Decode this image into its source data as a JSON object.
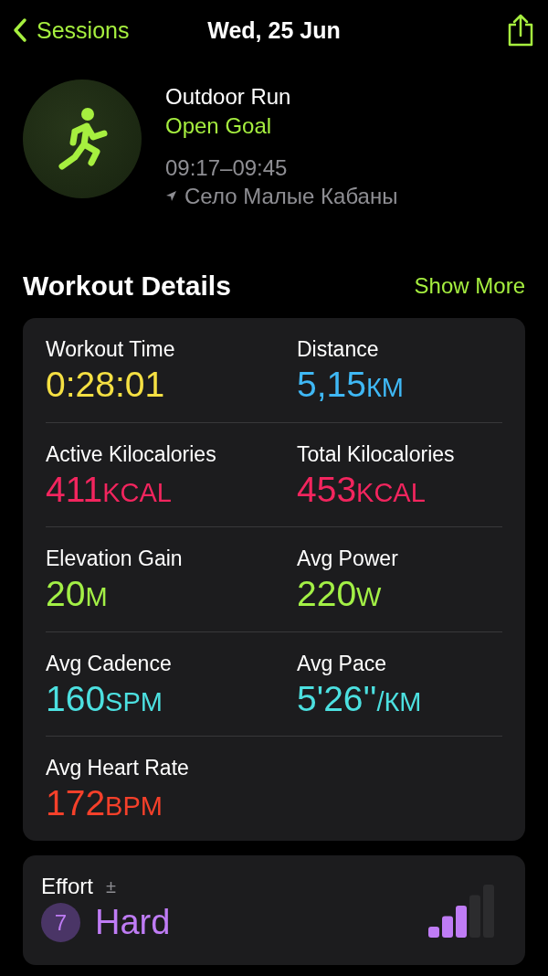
{
  "nav": {
    "back_label": "Sessions",
    "title": "Wed, 25 Jun"
  },
  "workout": {
    "name": "Outdoor Run",
    "goal": "Open Goal",
    "time_range": "09:17–09:45",
    "location": "Село Малые Кабаны"
  },
  "details": {
    "heading": "Workout Details",
    "more_link": "Show More",
    "metrics": [
      {
        "label": "Workout Time",
        "value": "0:28:01",
        "color": "#f5e043"
      },
      {
        "label": "Distance",
        "value": "5,15",
        "unit": "КМ",
        "color": "#3fb8f5"
      },
      {
        "label": "Active Kilocalories",
        "value": "411",
        "unit": "KCAL",
        "color": "#f2255e"
      },
      {
        "label": "Total Kilocalories",
        "value": "453",
        "unit": "KCAL",
        "color": "#f2255e"
      },
      {
        "label": "Elevation Gain",
        "value": "20",
        "unit": "М",
        "color": "#a3f046"
      },
      {
        "label": "Avg Power",
        "value": "220",
        "unit": "W",
        "color": "#a3f046"
      },
      {
        "label": "Avg Cadence",
        "value": "160",
        "unit": "SPM",
        "color": "#4ce0e0"
      },
      {
        "label": "Avg Pace",
        "value": "5'26''",
        "unit": "/КМ",
        "color": "#4ce0e0"
      },
      {
        "label": "Avg Heart Rate",
        "value": "172",
        "unit": "BPM",
        "color": "#f5402a"
      }
    ]
  },
  "effort": {
    "label": "Effort",
    "adjust": "±",
    "score": "7",
    "rating": "Hard",
    "level": 0.6
  }
}
